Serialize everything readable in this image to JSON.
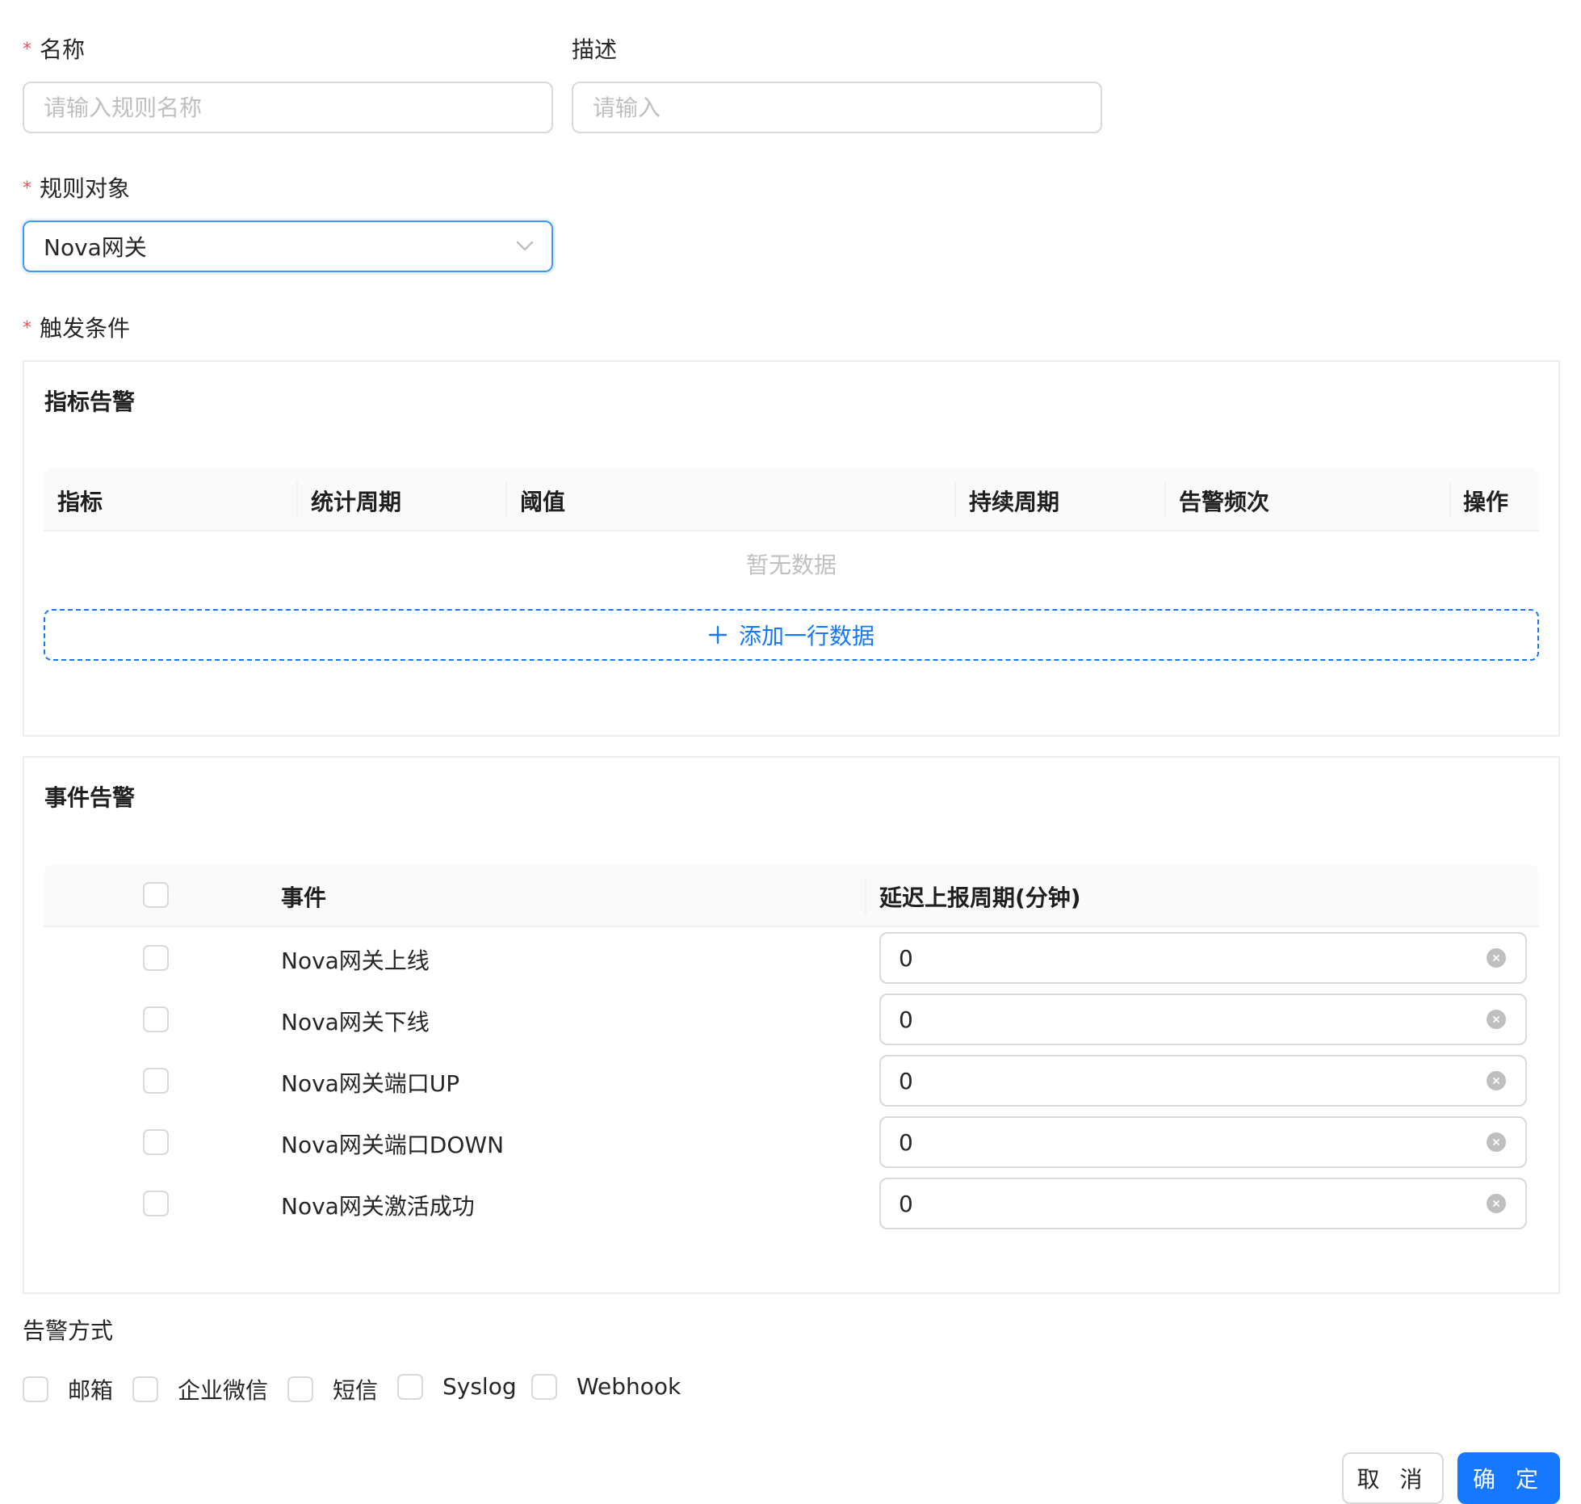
{
  "form": {
    "name": {
      "label": "名称",
      "required_mark": "*",
      "placeholder": "请输入规则名称",
      "value": ""
    },
    "description": {
      "label": "描述",
      "placeholder": "请输入",
      "value": ""
    },
    "rule_object": {
      "label": "规则对象",
      "required_mark": "*",
      "value": "Nova网关"
    },
    "trigger": {
      "label": "触发条件",
      "required_mark": "*"
    }
  },
  "metric_alarm": {
    "title": "指标告警",
    "columns": [
      "指标",
      "统计周期",
      "阈值",
      "持续周期",
      "告警频次",
      "操作"
    ],
    "empty_text": "暂无数据",
    "add_row_icon": "plus-icon",
    "add_row_label": "添加一行数据"
  },
  "event_alarm": {
    "title": "事件告警",
    "columns": [
      "事件",
      "延迟上报周期(分钟)"
    ],
    "rows": [
      {
        "event": "Nova网关上线",
        "delay": "0"
      },
      {
        "event": "Nova网关下线",
        "delay": "0"
      },
      {
        "event": "Nova网关端口UP",
        "delay": "0"
      },
      {
        "event": "Nova网关端口DOWN",
        "delay": "0"
      },
      {
        "event": "Nova网关激活成功",
        "delay": "0"
      }
    ]
  },
  "alarm_methods": {
    "label": "告警方式",
    "options": [
      "邮箱",
      "企业微信",
      "短信",
      "Syslog",
      "Webhook"
    ]
  },
  "footer": {
    "cancel_label": "取 消",
    "confirm_label": "确 定"
  },
  "colors": {
    "primary": "#1677ff",
    "required": "#ff4d4f",
    "border": "#d9d9d9",
    "placeholder": "#bfbfbf"
  }
}
